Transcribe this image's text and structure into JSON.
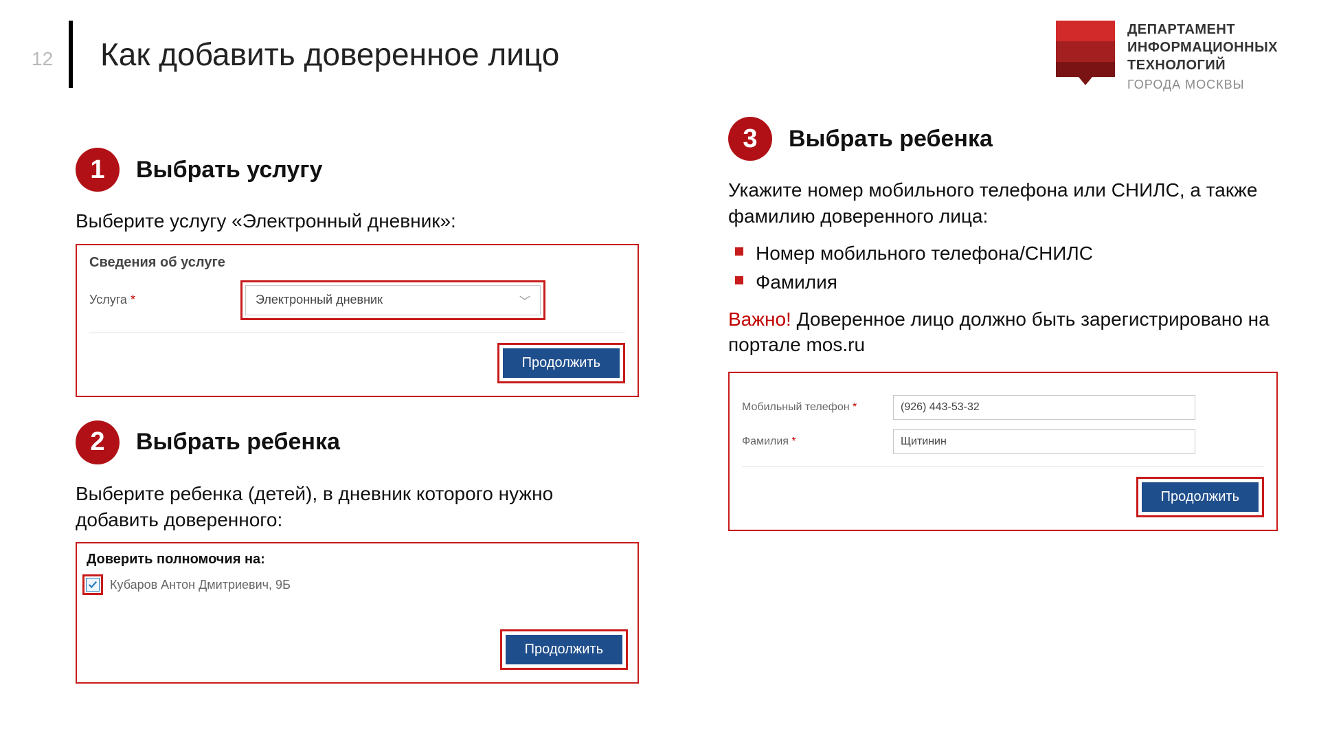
{
  "page_number": "12",
  "title": "Как добавить доверенное лицо",
  "org": {
    "line1": "ДЕПАРТАМЕНТ",
    "line2": "ИНФОРМАЦИОННЫХ",
    "line3": "ТЕХНОЛОГИЙ",
    "sub": "ГОРОДА МОСКВЫ"
  },
  "step1": {
    "num": "1",
    "title": "Выбрать услугу",
    "text": "Выберите услугу «Электронный дневник»:",
    "panel_title": "Сведения об услуге",
    "field_label": "Услуга",
    "req": "*",
    "select_value": "Электронный дневник",
    "continue": "Продолжить"
  },
  "step2": {
    "num": "2",
    "title": "Выбрать ребенка",
    "text": "Выберите ребенка (детей), в дневник которого нужно добавить доверенного:",
    "panel_title": "Доверить полномочия на:",
    "child": "Кубаров Антон Дмитриевич, 9Б",
    "continue": "Продолжить"
  },
  "step3": {
    "num": "3",
    "title": "Выбрать ребенка",
    "text": "Укажите номер мобильного телефона или СНИЛС, а также фамилию доверенного лица:",
    "bullet1": "Номер мобильного телефона/СНИЛС",
    "bullet2": "Фамилия",
    "warn_label": "Важно!",
    "warn_text": " Доверенное лицо должно быть зарегистрировано на портале mos.ru",
    "phone_label": "Мобильный телефон",
    "phone_req": "*",
    "phone_value": "(926) 443-53-32",
    "surname_label": "Фамилия",
    "surname_req": "*",
    "surname_value": "Щитинин",
    "continue": "Продолжить"
  }
}
